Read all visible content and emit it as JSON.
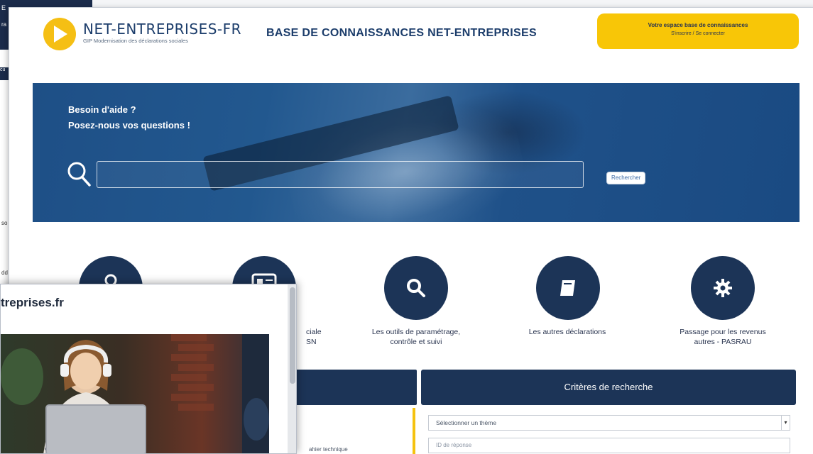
{
  "back_window": {
    "title_fragment": "E",
    "subtitle_fragment": "ra",
    "tab_fragment": "cu",
    "frag_1": "so",
    "frag_2": "dd"
  },
  "header": {
    "logo_title": "NET-ENTREPRISES-FR",
    "logo_subtitle": "GIP Modernisation des déclarations sociales",
    "kb_title": "BASE DE CONNAISSANCES NET-ENTREPRISES",
    "account_button": {
      "line1": "Votre espace base de connaissances",
      "line2": "S'inscrire / Se connecter"
    }
  },
  "hero": {
    "line1": "Besoin d'aide ?",
    "line2": "Posez-nous vos questions !",
    "search_value": "",
    "search_button": "Rechercher"
  },
  "categories": [
    {
      "label": "",
      "icon": "person-icon"
    },
    {
      "label": "ciale\nSN",
      "icon": "id-card-icon"
    },
    {
      "label": "Les outils de paramétrage,\ncontrôle et suivi",
      "icon": "search-icon"
    },
    {
      "label": "Les autres déclarations",
      "icon": "book-icon"
    },
    {
      "label": "Passage pour les revenus\nautres - PASRAU",
      "icon": "gear-icon"
    }
  ],
  "left_panel": {
    "fragment": "ahier technique"
  },
  "criteria": {
    "title": "Critères de recherche",
    "theme_select": "Sélectionner un thème",
    "response_id_placeholder": "ID de réponse"
  },
  "popup": {
    "title": "treprises.fr"
  },
  "colors": {
    "brand_yellow": "#f8c607",
    "brand_navy": "#1c3457",
    "hero_blue": "#22588f"
  }
}
